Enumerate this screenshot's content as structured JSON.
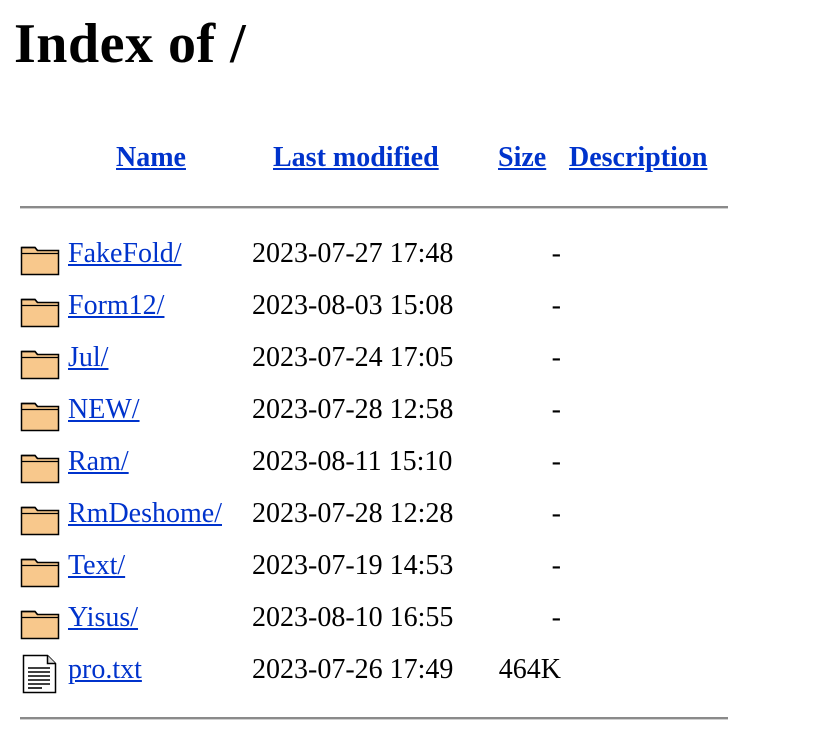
{
  "page": {
    "title": "Index of /"
  },
  "columns": {
    "name": "Name",
    "last_modified": "Last modified",
    "size": "Size",
    "description": "Description"
  },
  "entries": [
    {
      "name": "FakeFold/",
      "modified": "2023-07-27 17:48",
      "size": "-",
      "icon": "folder-icon"
    },
    {
      "name": "Form12/",
      "modified": "2023-08-03 15:08",
      "size": "-",
      "icon": "folder-icon"
    },
    {
      "name": "Jul/",
      "modified": "2023-07-24 17:05",
      "size": "-",
      "icon": "folder-icon"
    },
    {
      "name": "NEW/",
      "modified": "2023-07-28 12:58",
      "size": "-",
      "icon": "folder-icon"
    },
    {
      "name": "Ram/",
      "modified": "2023-08-11 15:10",
      "size": "-",
      "icon": "folder-icon"
    },
    {
      "name": "RmDeshome/",
      "modified": "2023-07-28 12:28",
      "size": "-",
      "icon": "folder-icon"
    },
    {
      "name": "Text/",
      "modified": "2023-07-19 14:53",
      "size": "-",
      "icon": "folder-icon"
    },
    {
      "name": "Yisus/",
      "modified": "2023-08-10 16:55",
      "size": "-",
      "icon": "folder-icon"
    },
    {
      "name": "pro.txt",
      "modified": "2023-07-26 17:49",
      "size": "464K",
      "icon": "text-file-icon"
    }
  ],
  "colors": {
    "link": "#0033cc",
    "folder_fill": "#f8c88c",
    "rule": "#8a8a8a"
  }
}
